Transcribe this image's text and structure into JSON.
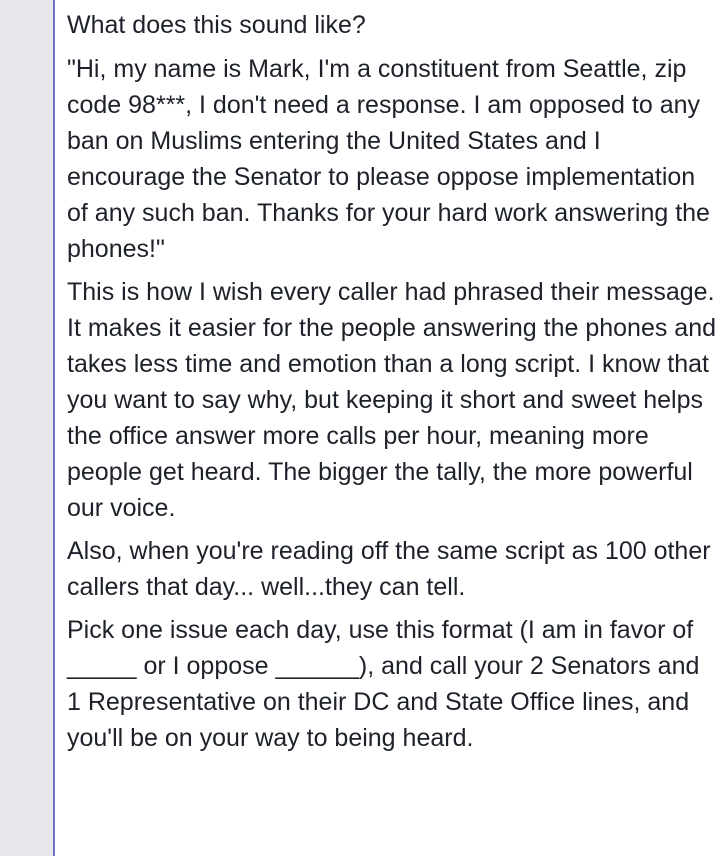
{
  "post": {
    "intro": "What does this sound like?",
    "quote": "\"Hi, my name is Mark, I'm a constituent from Seattle, zip code 98***, I don't need a response. I am opposed to any ban on Muslims entering the United States and I encourage the Senator to please oppose implementation of any such ban. Thanks for your hard work answering the phones!\"",
    "paragraph_1": "This is how I wish every caller had phrased their message. It makes it easier for the people answering the phones and takes less time and emotion than a long script. I know that you want to say why, but keeping it short and sweet helps the office answer more calls per hour, meaning more people get heard. The bigger the tally, the more powerful our voice.",
    "paragraph_2": "Also, when you're reading off the same script as 100 other callers that day... well...they can tell.",
    "paragraph_3": "Pick one issue each day, use this format (I am in favor of _____ or I oppose ______), and call your 2 Senators and 1 Representative on their DC and State Office lines, and you'll be on your way to being heard."
  },
  "colors": {
    "text": "#1d2129",
    "gutter": "#e6e7ea",
    "rule": "#6b72c8",
    "background": "#ffffff"
  }
}
